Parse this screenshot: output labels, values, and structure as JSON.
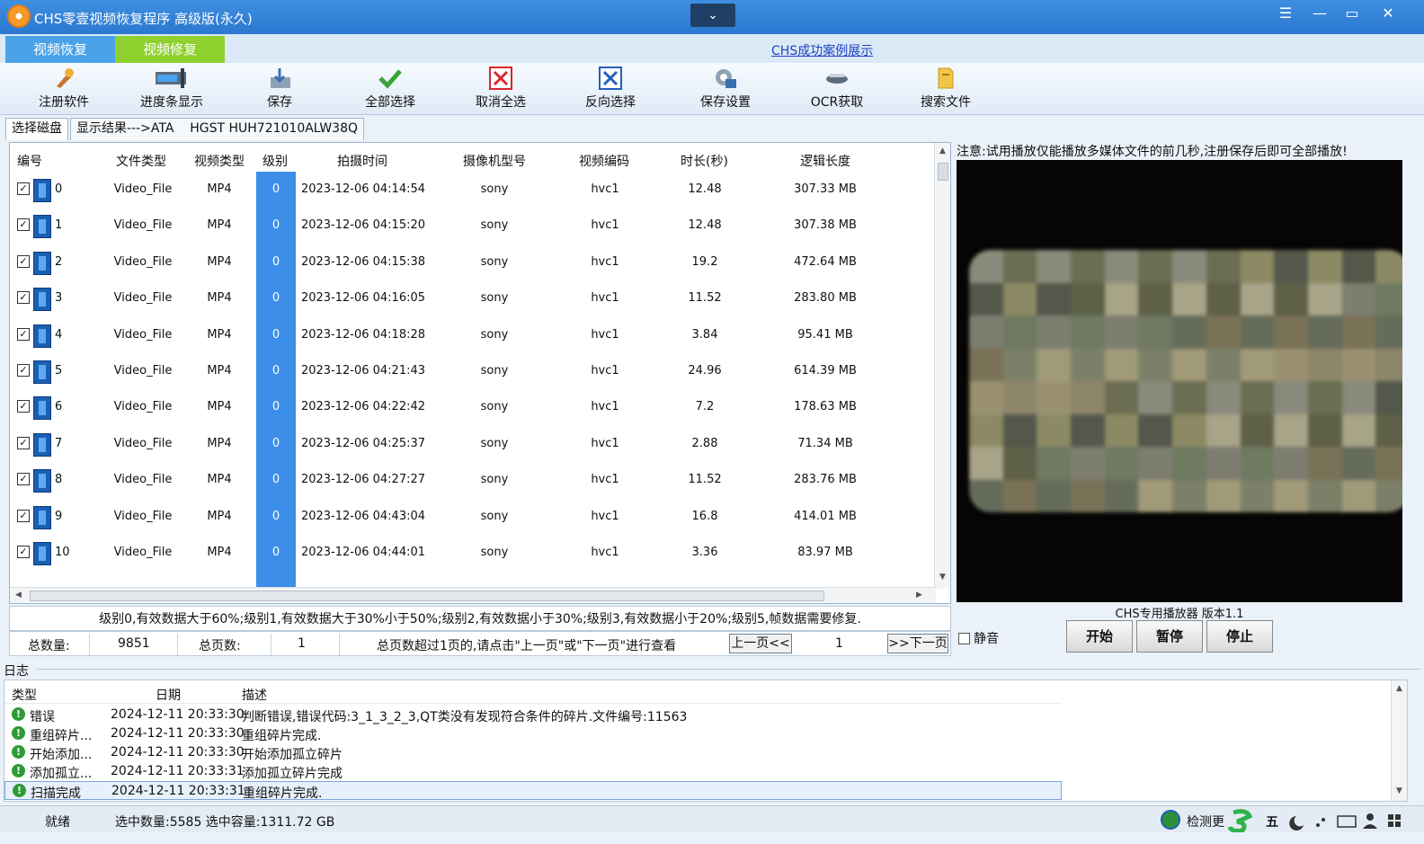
{
  "window": {
    "title": "CHS零壹视频恢复程序 高级版(永久)",
    "collapse_glyph": "⌄",
    "controls": {
      "menu": "☰",
      "minimize": "—",
      "restore": "▭",
      "close": "✕"
    }
  },
  "mode_tabs": [
    "视频恢复",
    "视频修复"
  ],
  "case_link": "CHS成功案例展示",
  "toolbar": [
    {
      "label": "注册软件",
      "icon": "register-icon"
    },
    {
      "label": "进度条显示",
      "icon": "progress-icon"
    },
    {
      "label": "保存",
      "icon": "save-icon"
    },
    {
      "label": "全部选择",
      "icon": "check-all-icon"
    },
    {
      "label": "取消全选",
      "icon": "uncheck-icon"
    },
    {
      "label": "反向选择",
      "icon": "invert-icon"
    },
    {
      "label": "保存设置",
      "icon": "settings-icon"
    },
    {
      "label": "OCR获取",
      "icon": "ocr-icon"
    },
    {
      "label": "搜索文件",
      "icon": "search-file-icon"
    }
  ],
  "disk_tabs": [
    "选择磁盘",
    "显示结果--->ATA    HGST HUH721010ALW38Q"
  ],
  "list": {
    "columns": [
      "编号",
      "文件类型",
      "视频类型",
      "级别",
      "拍摄时间",
      "摄像机型号",
      "视频编码",
      "时长(秒)",
      "逻辑长度"
    ],
    "rows": [
      {
        "id": "0",
        "ftype": "Video_File",
        "vtype": "MP4",
        "level": "0",
        "time": "2023-12-06 04:14:54",
        "camera": "sony",
        "codec": "hvc1",
        "duration": "12.48",
        "size": "307.33 MB",
        "checked": "✓"
      },
      {
        "id": "1",
        "ftype": "Video_File",
        "vtype": "MP4",
        "level": "0",
        "time": "2023-12-06 04:15:20",
        "camera": "sony",
        "codec": "hvc1",
        "duration": "12.48",
        "size": "307.38 MB",
        "checked": "✓"
      },
      {
        "id": "2",
        "ftype": "Video_File",
        "vtype": "MP4",
        "level": "0",
        "time": "2023-12-06 04:15:38",
        "camera": "sony",
        "codec": "hvc1",
        "duration": "19.2",
        "size": "472.64 MB",
        "checked": "✓"
      },
      {
        "id": "3",
        "ftype": "Video_File",
        "vtype": "MP4",
        "level": "0",
        "time": "2023-12-06 04:16:05",
        "camera": "sony",
        "codec": "hvc1",
        "duration": "11.52",
        "size": "283.80 MB",
        "checked": "✓"
      },
      {
        "id": "4",
        "ftype": "Video_File",
        "vtype": "MP4",
        "level": "0",
        "time": "2023-12-06 04:18:28",
        "camera": "sony",
        "codec": "hvc1",
        "duration": "3.84",
        "size": "95.41 MB",
        "checked": "✓"
      },
      {
        "id": "5",
        "ftype": "Video_File",
        "vtype": "MP4",
        "level": "0",
        "time": "2023-12-06 04:21:43",
        "camera": "sony",
        "codec": "hvc1",
        "duration": "24.96",
        "size": "614.39 MB",
        "checked": "✓"
      },
      {
        "id": "6",
        "ftype": "Video_File",
        "vtype": "MP4",
        "level": "0",
        "time": "2023-12-06 04:22:42",
        "camera": "sony",
        "codec": "hvc1",
        "duration": "7.2",
        "size": "178.63 MB",
        "checked": "✓"
      },
      {
        "id": "7",
        "ftype": "Video_File",
        "vtype": "MP4",
        "level": "0",
        "time": "2023-12-06 04:25:37",
        "camera": "sony",
        "codec": "hvc1",
        "duration": "2.88",
        "size": "71.34 MB",
        "checked": "✓"
      },
      {
        "id": "8",
        "ftype": "Video_File",
        "vtype": "MP4",
        "level": "0",
        "time": "2023-12-06 04:27:27",
        "camera": "sony",
        "codec": "hvc1",
        "duration": "11.52",
        "size": "283.76 MB",
        "checked": "✓"
      },
      {
        "id": "9",
        "ftype": "Video_File",
        "vtype": "MP4",
        "level": "0",
        "time": "2023-12-06 04:43:04",
        "camera": "sony",
        "codec": "hvc1",
        "duration": "16.8",
        "size": "414.01 MB",
        "checked": "✓"
      },
      {
        "id": "10",
        "ftype": "Video_File",
        "vtype": "MP4",
        "level": "0",
        "time": "2023-12-06 04:44:01",
        "camera": "sony",
        "codec": "hvc1",
        "duration": "3.36",
        "size": "83.97 MB",
        "checked": "✓"
      }
    ]
  },
  "level_note": "级别0,有效数据大于60%;级别1,有效数据大于30%小于50%;级别2,有效数据小于30%;级别3,有效数据小于20%;级别5,帧数据需要修复.",
  "pager": {
    "total_label": "总数量:",
    "total_value": "9851",
    "pages_label": "总页数:",
    "pages_value": "1",
    "hint": "总页数超过1页的,请点击\"上一页\"或\"下一页\"进行查看",
    "prev": "上一页<<",
    "current": "1",
    "next": ">>下一页"
  },
  "player": {
    "note": "注意:试用播放仅能播放多媒体文件的前几秒,注册保存后即可全部播放!",
    "version": "CHS专用播放器 版本1.1",
    "mute_label": "静音",
    "buttons": [
      "开始",
      "暂停",
      "停止"
    ]
  },
  "log": {
    "title": "日志",
    "columns": [
      "类型",
      "日期",
      "描述"
    ],
    "rows": [
      {
        "type": "错误",
        "date": "2024-12-11 20:33:30",
        "desc": "判断错误,错误代码:3_1_3_2_3,QT类没有发现符合条件的碎片.文件编号:11563"
      },
      {
        "type": "重组碎片...",
        "date": "2024-12-11 20:33:30",
        "desc": "重组碎片完成."
      },
      {
        "type": "开始添加...",
        "date": "2024-12-11 20:33:30",
        "desc": "开始添加孤立碎片"
      },
      {
        "type": "添加孤立...",
        "date": "2024-12-11 20:33:31",
        "desc": "添加孤立碎片完成"
      },
      {
        "type": "扫描完成",
        "date": "2024-12-11 20:33:31",
        "desc": "重组碎片完成."
      }
    ]
  },
  "status": {
    "ready": "就绪",
    "selection": "选中数量:5585 选中容量:1311.72 GB",
    "check_update": "检测更",
    "ime": "五"
  },
  "colors": {
    "titlebar": "#2f83d8",
    "tab_blue": "#4aa3e8",
    "tab_green": "#8ed12f",
    "level_col": "#3c8ee8"
  }
}
